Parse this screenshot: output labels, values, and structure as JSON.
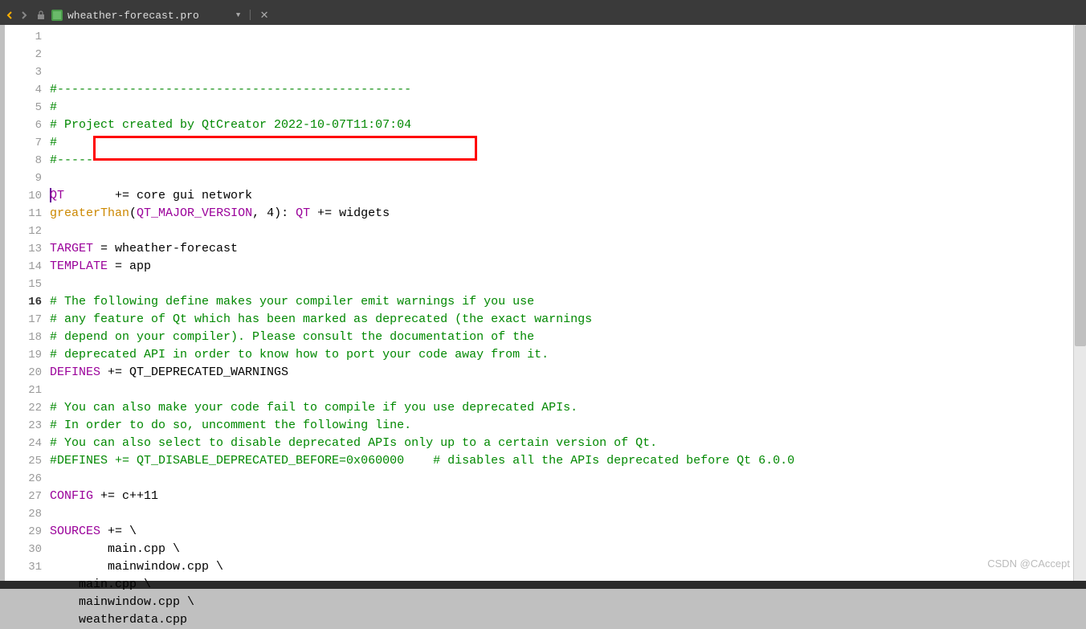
{
  "tab": {
    "filename": "wheather-forecast.pro"
  },
  "watermark": "CSDN @CAccept",
  "current_line": 16,
  "highlighted_line": 7,
  "lines": [
    {
      "n": 1,
      "spans": [
        {
          "t": "#-------------------------------------------------",
          "c": "c-comment"
        }
      ]
    },
    {
      "n": 2,
      "spans": [
        {
          "t": "#",
          "c": "c-comment"
        }
      ]
    },
    {
      "n": 3,
      "spans": [
        {
          "t": "# Project created by QtCreator 2022-10-07T11:07:04",
          "c": "c-comment"
        }
      ]
    },
    {
      "n": 4,
      "spans": [
        {
          "t": "#",
          "c": "c-comment"
        }
      ]
    },
    {
      "n": 5,
      "spans": [
        {
          "t": "#-------------------------------------------------",
          "c": "c-comment"
        }
      ]
    },
    {
      "n": 6,
      "spans": []
    },
    {
      "n": 7,
      "spans": [
        {
          "t": "QT",
          "c": "c-keyword"
        },
        {
          "t": "       += core gui network",
          "c": "c-plain"
        }
      ],
      "cursor": true
    },
    {
      "n": 8,
      "spans": [
        {
          "t": "greaterThan",
          "c": "c-func"
        },
        {
          "t": "(",
          "c": "c-plain"
        },
        {
          "t": "QT_MAJOR_VERSION",
          "c": "c-keyword"
        },
        {
          "t": ", 4): ",
          "c": "c-plain"
        },
        {
          "t": "QT",
          "c": "c-keyword"
        },
        {
          "t": " += widgets",
          "c": "c-plain"
        }
      ]
    },
    {
      "n": 9,
      "spans": []
    },
    {
      "n": 10,
      "spans": [
        {
          "t": "TARGET",
          "c": "c-keyword"
        },
        {
          "t": " = wheather-forecast",
          "c": "c-plain"
        }
      ]
    },
    {
      "n": 11,
      "spans": [
        {
          "t": "TEMPLATE",
          "c": "c-keyword"
        },
        {
          "t": " = app",
          "c": "c-plain"
        }
      ]
    },
    {
      "n": 12,
      "spans": []
    },
    {
      "n": 13,
      "spans": [
        {
          "t": "# The following define makes your compiler emit warnings if you use",
          "c": "c-comment"
        }
      ]
    },
    {
      "n": 14,
      "spans": [
        {
          "t": "# any feature of Qt which has been marked as deprecated (the exact warnings",
          "c": "c-comment"
        }
      ]
    },
    {
      "n": 15,
      "spans": [
        {
          "t": "# depend on your compiler). Please consult the documentation of the",
          "c": "c-comment"
        }
      ]
    },
    {
      "n": 16,
      "spans": [
        {
          "t": "# deprecated API in order to know how to port your code away from it.",
          "c": "c-comment"
        }
      ]
    },
    {
      "n": 17,
      "spans": [
        {
          "t": "DEFINES",
          "c": "c-keyword"
        },
        {
          "t": " += QT_DEPRECATED_WARNINGS",
          "c": "c-plain"
        }
      ]
    },
    {
      "n": 18,
      "spans": []
    },
    {
      "n": 19,
      "spans": [
        {
          "t": "# You can also make your code fail to compile if you use deprecated APIs.",
          "c": "c-comment"
        }
      ]
    },
    {
      "n": 20,
      "spans": [
        {
          "t": "# In order to do so, uncomment the following line.",
          "c": "c-comment"
        }
      ]
    },
    {
      "n": 21,
      "spans": [
        {
          "t": "# You can also select to disable deprecated APIs only up to a certain version of Qt.",
          "c": "c-comment"
        }
      ]
    },
    {
      "n": 22,
      "spans": [
        {
          "t": "#DEFINES += QT_DISABLE_DEPRECATED_BEFORE=0x060000    # disables all the APIs deprecated before Qt 6.0.0",
          "c": "c-comment"
        }
      ]
    },
    {
      "n": 23,
      "spans": []
    },
    {
      "n": 24,
      "spans": [
        {
          "t": "CONFIG",
          "c": "c-keyword"
        },
        {
          "t": " += c++11",
          "c": "c-plain"
        }
      ]
    },
    {
      "n": 25,
      "spans": []
    },
    {
      "n": 26,
      "spans": [
        {
          "t": "SOURCES",
          "c": "c-keyword"
        },
        {
          "t": " += \\",
          "c": "c-plain"
        }
      ]
    },
    {
      "n": 27,
      "spans": [
        {
          "t": "        main.cpp \\",
          "c": "c-plain"
        }
      ]
    },
    {
      "n": 28,
      "spans": [
        {
          "t": "        mainwindow.cpp \\",
          "c": "c-plain"
        }
      ]
    },
    {
      "n": 29,
      "spans": [
        {
          "t": "    main.cpp \\",
          "c": "c-plain"
        }
      ]
    },
    {
      "n": 30,
      "spans": [
        {
          "t": "    mainwindow.cpp \\",
          "c": "c-plain"
        }
      ]
    },
    {
      "n": 31,
      "spans": [
        {
          "t": "    weatherdata.cpp",
          "c": "c-plain"
        }
      ]
    }
  ]
}
